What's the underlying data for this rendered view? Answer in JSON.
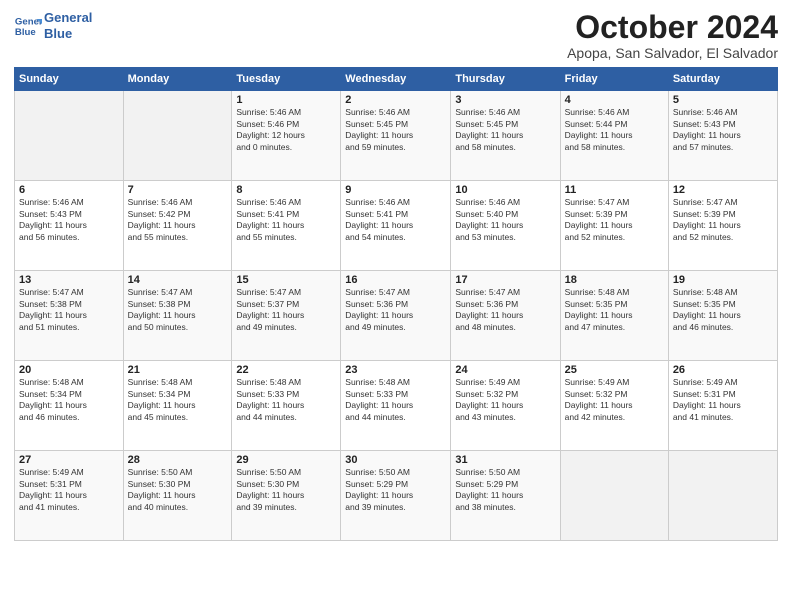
{
  "header": {
    "logo_line1": "General",
    "logo_line2": "Blue",
    "month": "October 2024",
    "location": "Apopa, San Salvador, El Salvador"
  },
  "weekdays": [
    "Sunday",
    "Monday",
    "Tuesday",
    "Wednesday",
    "Thursday",
    "Friday",
    "Saturday"
  ],
  "weeks": [
    [
      {
        "day": "",
        "info": ""
      },
      {
        "day": "",
        "info": ""
      },
      {
        "day": "1",
        "info": "Sunrise: 5:46 AM\nSunset: 5:46 PM\nDaylight: 12 hours\nand 0 minutes."
      },
      {
        "day": "2",
        "info": "Sunrise: 5:46 AM\nSunset: 5:45 PM\nDaylight: 11 hours\nand 59 minutes."
      },
      {
        "day": "3",
        "info": "Sunrise: 5:46 AM\nSunset: 5:45 PM\nDaylight: 11 hours\nand 58 minutes."
      },
      {
        "day": "4",
        "info": "Sunrise: 5:46 AM\nSunset: 5:44 PM\nDaylight: 11 hours\nand 58 minutes."
      },
      {
        "day": "5",
        "info": "Sunrise: 5:46 AM\nSunset: 5:43 PM\nDaylight: 11 hours\nand 57 minutes."
      }
    ],
    [
      {
        "day": "6",
        "info": "Sunrise: 5:46 AM\nSunset: 5:43 PM\nDaylight: 11 hours\nand 56 minutes."
      },
      {
        "day": "7",
        "info": "Sunrise: 5:46 AM\nSunset: 5:42 PM\nDaylight: 11 hours\nand 55 minutes."
      },
      {
        "day": "8",
        "info": "Sunrise: 5:46 AM\nSunset: 5:41 PM\nDaylight: 11 hours\nand 55 minutes."
      },
      {
        "day": "9",
        "info": "Sunrise: 5:46 AM\nSunset: 5:41 PM\nDaylight: 11 hours\nand 54 minutes."
      },
      {
        "day": "10",
        "info": "Sunrise: 5:46 AM\nSunset: 5:40 PM\nDaylight: 11 hours\nand 53 minutes."
      },
      {
        "day": "11",
        "info": "Sunrise: 5:47 AM\nSunset: 5:39 PM\nDaylight: 11 hours\nand 52 minutes."
      },
      {
        "day": "12",
        "info": "Sunrise: 5:47 AM\nSunset: 5:39 PM\nDaylight: 11 hours\nand 52 minutes."
      }
    ],
    [
      {
        "day": "13",
        "info": "Sunrise: 5:47 AM\nSunset: 5:38 PM\nDaylight: 11 hours\nand 51 minutes."
      },
      {
        "day": "14",
        "info": "Sunrise: 5:47 AM\nSunset: 5:38 PM\nDaylight: 11 hours\nand 50 minutes."
      },
      {
        "day": "15",
        "info": "Sunrise: 5:47 AM\nSunset: 5:37 PM\nDaylight: 11 hours\nand 49 minutes."
      },
      {
        "day": "16",
        "info": "Sunrise: 5:47 AM\nSunset: 5:36 PM\nDaylight: 11 hours\nand 49 minutes."
      },
      {
        "day": "17",
        "info": "Sunrise: 5:47 AM\nSunset: 5:36 PM\nDaylight: 11 hours\nand 48 minutes."
      },
      {
        "day": "18",
        "info": "Sunrise: 5:48 AM\nSunset: 5:35 PM\nDaylight: 11 hours\nand 47 minutes."
      },
      {
        "day": "19",
        "info": "Sunrise: 5:48 AM\nSunset: 5:35 PM\nDaylight: 11 hours\nand 46 minutes."
      }
    ],
    [
      {
        "day": "20",
        "info": "Sunrise: 5:48 AM\nSunset: 5:34 PM\nDaylight: 11 hours\nand 46 minutes."
      },
      {
        "day": "21",
        "info": "Sunrise: 5:48 AM\nSunset: 5:34 PM\nDaylight: 11 hours\nand 45 minutes."
      },
      {
        "day": "22",
        "info": "Sunrise: 5:48 AM\nSunset: 5:33 PM\nDaylight: 11 hours\nand 44 minutes."
      },
      {
        "day": "23",
        "info": "Sunrise: 5:48 AM\nSunset: 5:33 PM\nDaylight: 11 hours\nand 44 minutes."
      },
      {
        "day": "24",
        "info": "Sunrise: 5:49 AM\nSunset: 5:32 PM\nDaylight: 11 hours\nand 43 minutes."
      },
      {
        "day": "25",
        "info": "Sunrise: 5:49 AM\nSunset: 5:32 PM\nDaylight: 11 hours\nand 42 minutes."
      },
      {
        "day": "26",
        "info": "Sunrise: 5:49 AM\nSunset: 5:31 PM\nDaylight: 11 hours\nand 41 minutes."
      }
    ],
    [
      {
        "day": "27",
        "info": "Sunrise: 5:49 AM\nSunset: 5:31 PM\nDaylight: 11 hours\nand 41 minutes."
      },
      {
        "day": "28",
        "info": "Sunrise: 5:50 AM\nSunset: 5:30 PM\nDaylight: 11 hours\nand 40 minutes."
      },
      {
        "day": "29",
        "info": "Sunrise: 5:50 AM\nSunset: 5:30 PM\nDaylight: 11 hours\nand 39 minutes."
      },
      {
        "day": "30",
        "info": "Sunrise: 5:50 AM\nSunset: 5:29 PM\nDaylight: 11 hours\nand 39 minutes."
      },
      {
        "day": "31",
        "info": "Sunrise: 5:50 AM\nSunset: 5:29 PM\nDaylight: 11 hours\nand 38 minutes."
      },
      {
        "day": "",
        "info": ""
      },
      {
        "day": "",
        "info": ""
      }
    ]
  ]
}
